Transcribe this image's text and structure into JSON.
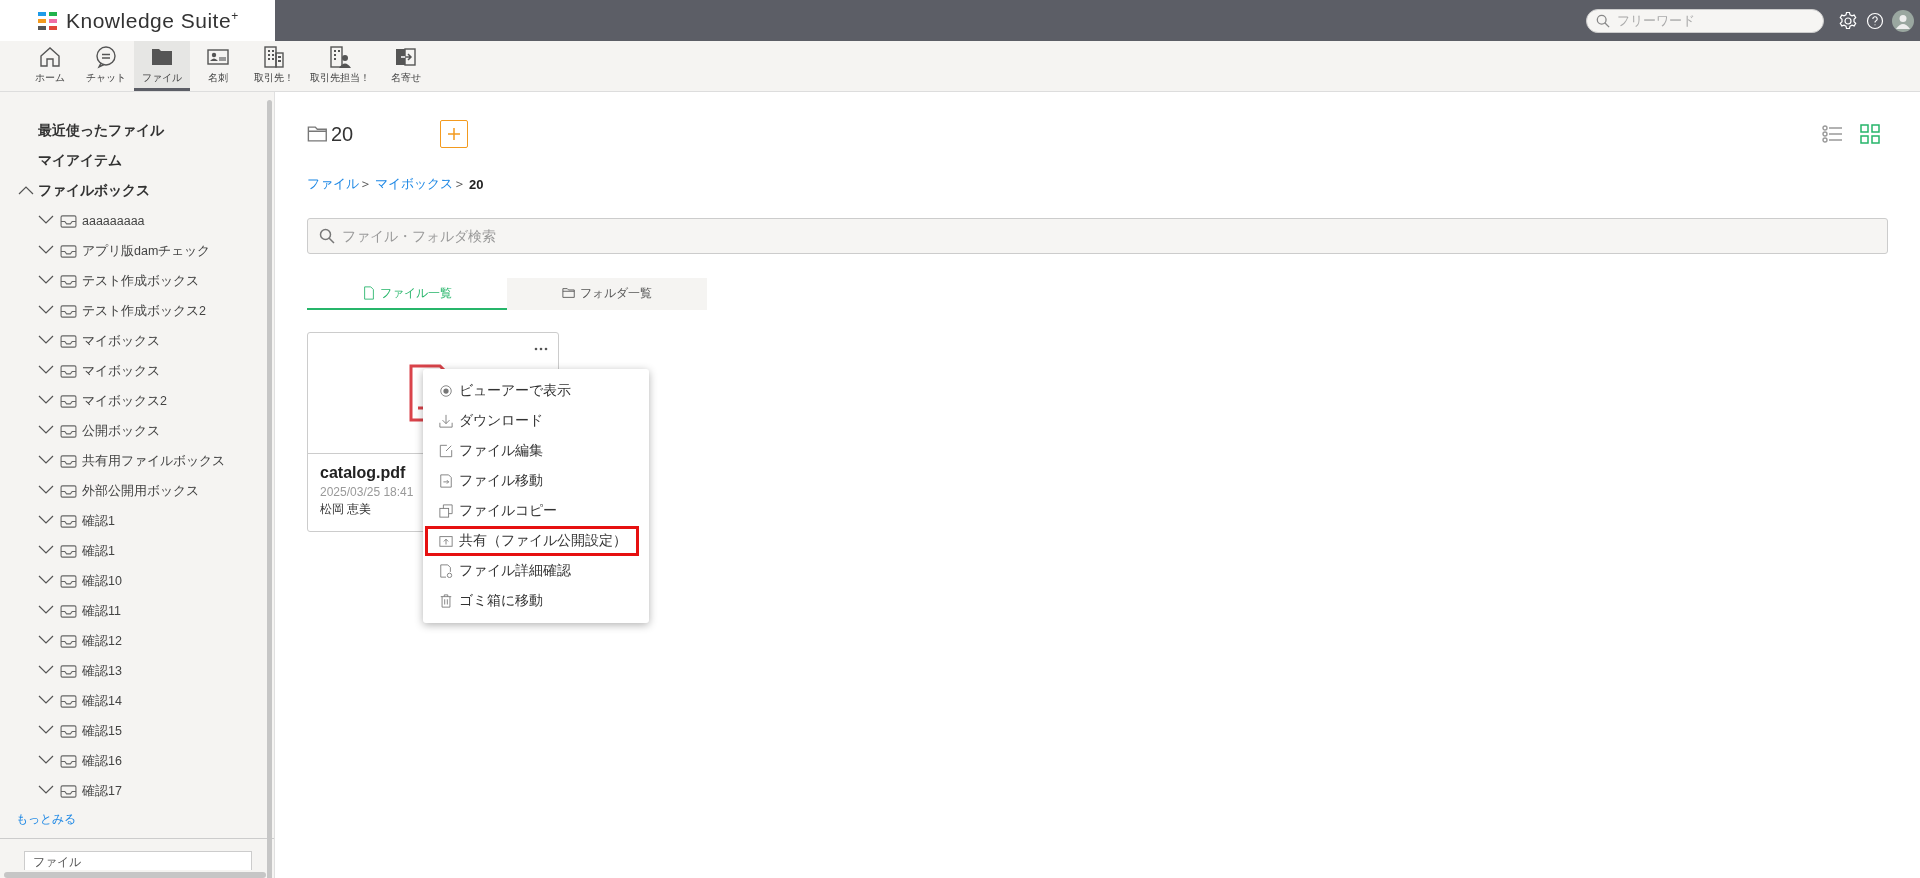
{
  "header": {
    "logo": "Knowledge Suite",
    "logo_mark": "+",
    "search": {
      "placeholder": "フリーワード"
    }
  },
  "nav": [
    {
      "label": "ホーム",
      "kind": "home",
      "selected": false
    },
    {
      "label": "チャット",
      "kind": "chat",
      "selected": false
    },
    {
      "label": "ファイル",
      "kind": "folder",
      "selected": true
    },
    {
      "label": "名刺",
      "kind": "card",
      "selected": false
    },
    {
      "label": "取引先！",
      "kind": "building",
      "selected": false
    },
    {
      "label": "取引先担当！",
      "kind": "building-person",
      "selected": false
    },
    {
      "label": "名寄せ",
      "kind": "merge",
      "selected": false
    }
  ],
  "sidebar": {
    "links": [
      {
        "label": "最近使ったファイル"
      },
      {
        "label": "マイアイテム"
      }
    ],
    "tree": {
      "label": "ファイルボックス",
      "expanded": true,
      "children": [
        {
          "label": "aaaaaaaaa",
          "expanded": false
        },
        {
          "label": "アプリ版damチェック",
          "expanded": false
        },
        {
          "label": "テスト作成ボックス",
          "expanded": false
        },
        {
          "label": "テスト作成ボックス2",
          "expanded": false
        },
        {
          "label": "マイボックス",
          "expanded": false
        },
        {
          "label": "マイボックス",
          "expanded": false
        },
        {
          "label": "マイボックス2",
          "expanded": false
        },
        {
          "label": "公開ボックス",
          "expanded": false
        },
        {
          "label": "共有用ファイルボックス",
          "expanded": false
        },
        {
          "label": "外部公開用ボックス",
          "expanded": false
        },
        {
          "label": "確認1",
          "expanded": false
        },
        {
          "label": "確認1",
          "expanded": false
        },
        {
          "label": "確認10",
          "expanded": false
        },
        {
          "label": "確認11",
          "expanded": false
        },
        {
          "label": "確認12",
          "expanded": false
        },
        {
          "label": "確認13",
          "expanded": false
        },
        {
          "label": "確認14",
          "expanded": false
        },
        {
          "label": "確認15",
          "expanded": false
        },
        {
          "label": "確認16",
          "expanded": false
        },
        {
          "label": "確認17",
          "expanded": false
        }
      ]
    },
    "more": "もっとみる",
    "filter": {
      "value": "ファイル"
    }
  },
  "main": {
    "folder": "20",
    "view_modes": [
      {
        "kind": "list",
        "selected": false
      },
      {
        "kind": "grid",
        "selected": true
      }
    ],
    "breadcrumb": [
      {
        "label": "ファイル",
        "separator": "＞",
        "current": false
      },
      {
        "label": "マイボックス",
        "separator": "＞",
        "current": false
      },
      {
        "label": "20",
        "current": true
      }
    ],
    "search": {
      "placeholder": "ファイル・フォルダ検索"
    },
    "tabs": [
      {
        "label": "ファイル一覧",
        "kind": "file",
        "selected": true
      },
      {
        "label": "フォルダ一覧",
        "kind": "folder",
        "selected": false
      }
    ],
    "files": [
      {
        "name": "catalog.pdf",
        "date": "2025/03/25 18:41",
        "owner": "松岡 恵美"
      }
    ],
    "context_menu": [
      {
        "label": "ビューアーで表示",
        "kind": "eye",
        "highlighted": false
      },
      {
        "label": "ダウンロード",
        "kind": "download",
        "highlighted": false
      },
      {
        "label": "ファイル編集",
        "kind": "edit",
        "highlighted": false
      },
      {
        "label": "ファイル移動",
        "kind": "move",
        "highlighted": false
      },
      {
        "label": "ファイルコピー",
        "kind": "copy",
        "highlighted": false
      },
      {
        "label": "共有（ファイル公開設定）",
        "kind": "share",
        "highlighted": true
      },
      {
        "label": "ファイル詳細確認",
        "kind": "details",
        "highlighted": false
      },
      {
        "label": "ゴミ箱に移動",
        "kind": "trash",
        "highlighted": false
      }
    ]
  }
}
